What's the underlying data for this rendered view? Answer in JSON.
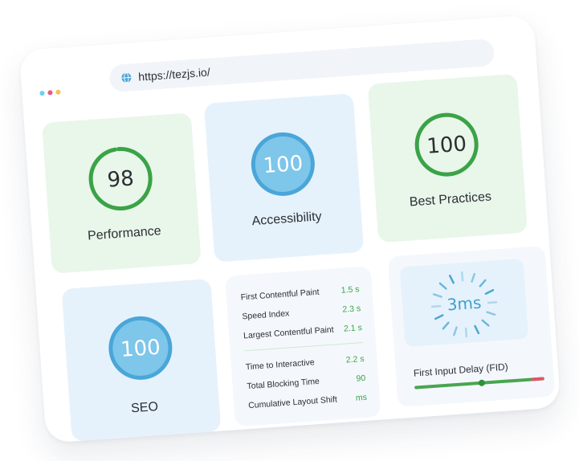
{
  "browser": {
    "url": "https://tezjs.io/",
    "window_dots": [
      "#6ad0f0",
      "#e45b83",
      "#f4c24d"
    ]
  },
  "colors": {
    "good_green": "#3aa347",
    "info_blue": "#4aa6d8",
    "blue_fill": "#7ec6ea",
    "tile_green": "#e9f6ea",
    "tile_blue": "#e6f2fb",
    "bar_red": "#e0556b"
  },
  "scores": {
    "performance": {
      "value": "98",
      "label": "Performance",
      "fraction": 0.98
    },
    "accessibility": {
      "value": "100",
      "label": "Accessibility",
      "fraction": 1.0
    },
    "best_practices": {
      "value": "100",
      "label": "Best Practices",
      "fraction": 1.0
    },
    "seo": {
      "value": "100",
      "label": "SEO",
      "fraction": 1.0
    }
  },
  "metrics": {
    "group1": [
      {
        "label": "First Contentful Paint",
        "value": "1.5 s"
      },
      {
        "label": "Speed Index",
        "value": "2.3 s"
      },
      {
        "label": "Largest Contentful Paint",
        "value": "2.1 s"
      }
    ],
    "group2": [
      {
        "label": "Time to Interactive",
        "value": "2.2 s"
      },
      {
        "label": "Total Blocking Time",
        "value": "90"
      },
      {
        "label": "Cumulative Layout Shift",
        "value": "ms"
      }
    ]
  },
  "fid": {
    "value": "3ms",
    "label": "First Input Delay (FID)",
    "marker_fraction": 0.52
  },
  "icons": {
    "url_icon": "globe-icon"
  }
}
